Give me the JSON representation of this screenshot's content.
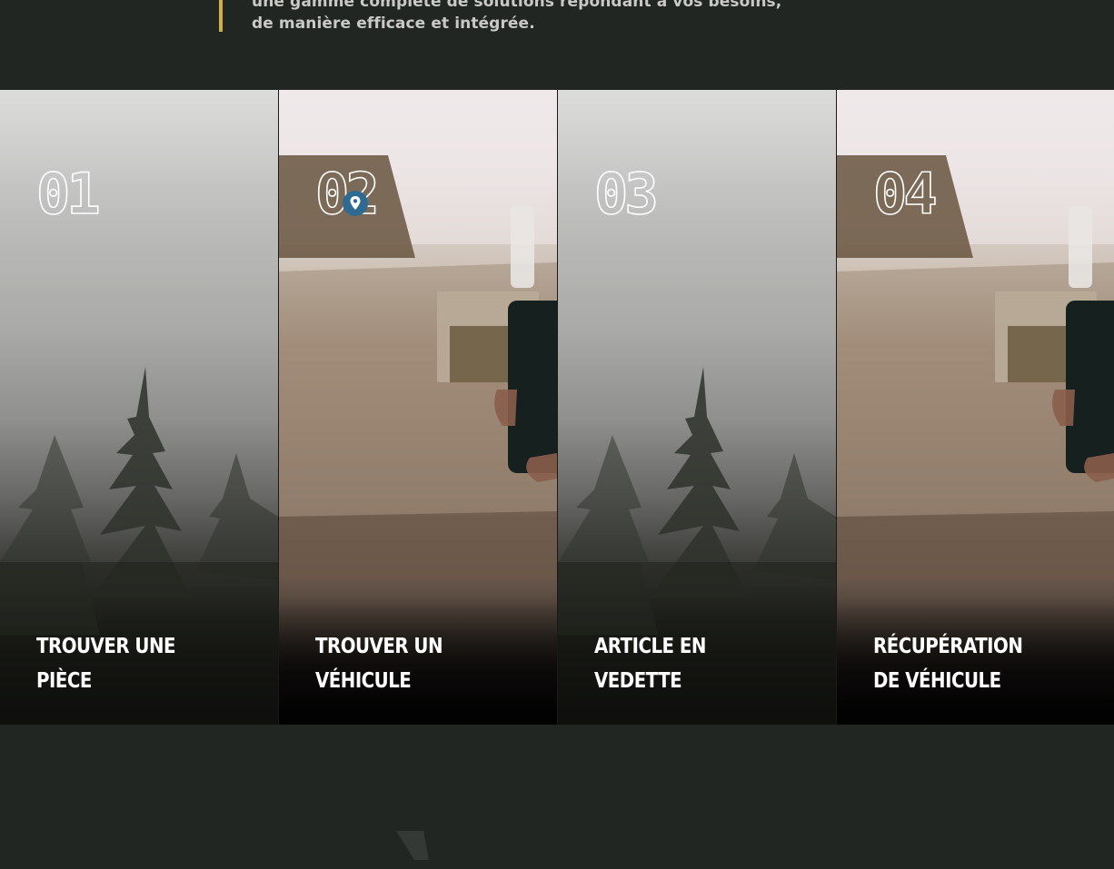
{
  "intro": {
    "line1": "une gamme complète de solutions répondant à vos besoins,",
    "line2": "de manière efficace et intégrée."
  },
  "colors": {
    "background": "#222623",
    "accent_bar": "#d4ae3c",
    "pin": "#2f6a92"
  },
  "cards": [
    {
      "number": "01",
      "title_line1": "TROUVER UNE",
      "title_line2": "PIÈCE",
      "scene": "forest-image"
    },
    {
      "number": "02",
      "title_line1": "TROUVER UN",
      "title_line2": "VÉHICULE",
      "scene": "table-phone-image"
    },
    {
      "number": "03",
      "title_line1": "ARTICLE EN",
      "title_line2": "VEDETTE",
      "scene": "forest-image"
    },
    {
      "number": "04",
      "title_line1": "RÉCUPÉRATION",
      "title_line2": "DE VÉHICULE",
      "scene": "table-phone-image"
    }
  ],
  "icons": {
    "pin": "map-pin-icon"
  }
}
